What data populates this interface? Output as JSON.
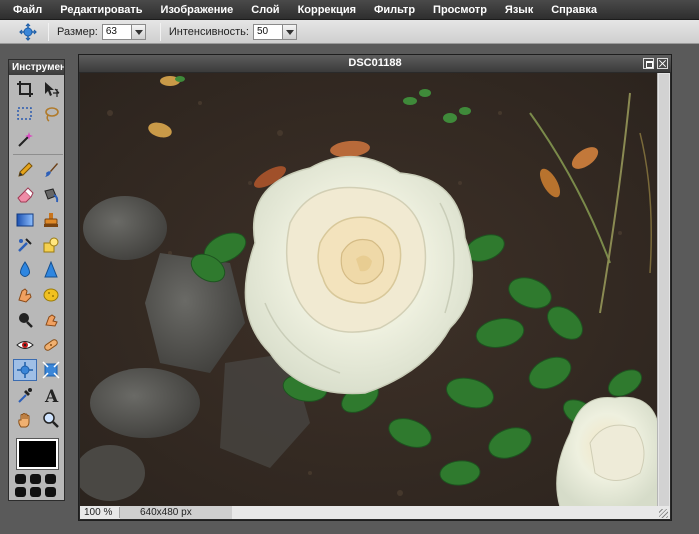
{
  "menu": {
    "items": [
      "Файл",
      "Редактировать",
      "Изображение",
      "Слой",
      "Коррекция",
      "Фильтр",
      "Просмотр",
      "Язык",
      "Справка"
    ]
  },
  "options": {
    "size_label": "Размер:",
    "size_value": "63",
    "intensity_label": "Интенсивность:",
    "intensity_value": "50"
  },
  "toolbox": {
    "title": "Инструменты",
    "tools": [
      "crop",
      "move",
      "marquee",
      "lasso",
      "magic-wand",
      "pencil",
      "brush",
      "eraser",
      "replace-color",
      "gradient",
      "clone-stamp",
      "color-replace",
      "shape",
      "blur",
      "sharpen",
      "smudge",
      "sponge",
      "burn",
      "dodge",
      "red-eye",
      "spot-heal",
      "bloat",
      "pinch",
      "color-picker",
      "text",
      "hand",
      "zoom"
    ],
    "active_tool": "bloat",
    "primary_color": "#000000"
  },
  "image_window": {
    "title": "DSC01188",
    "zoom": "100 %",
    "dimensions": "640x480 px"
  }
}
